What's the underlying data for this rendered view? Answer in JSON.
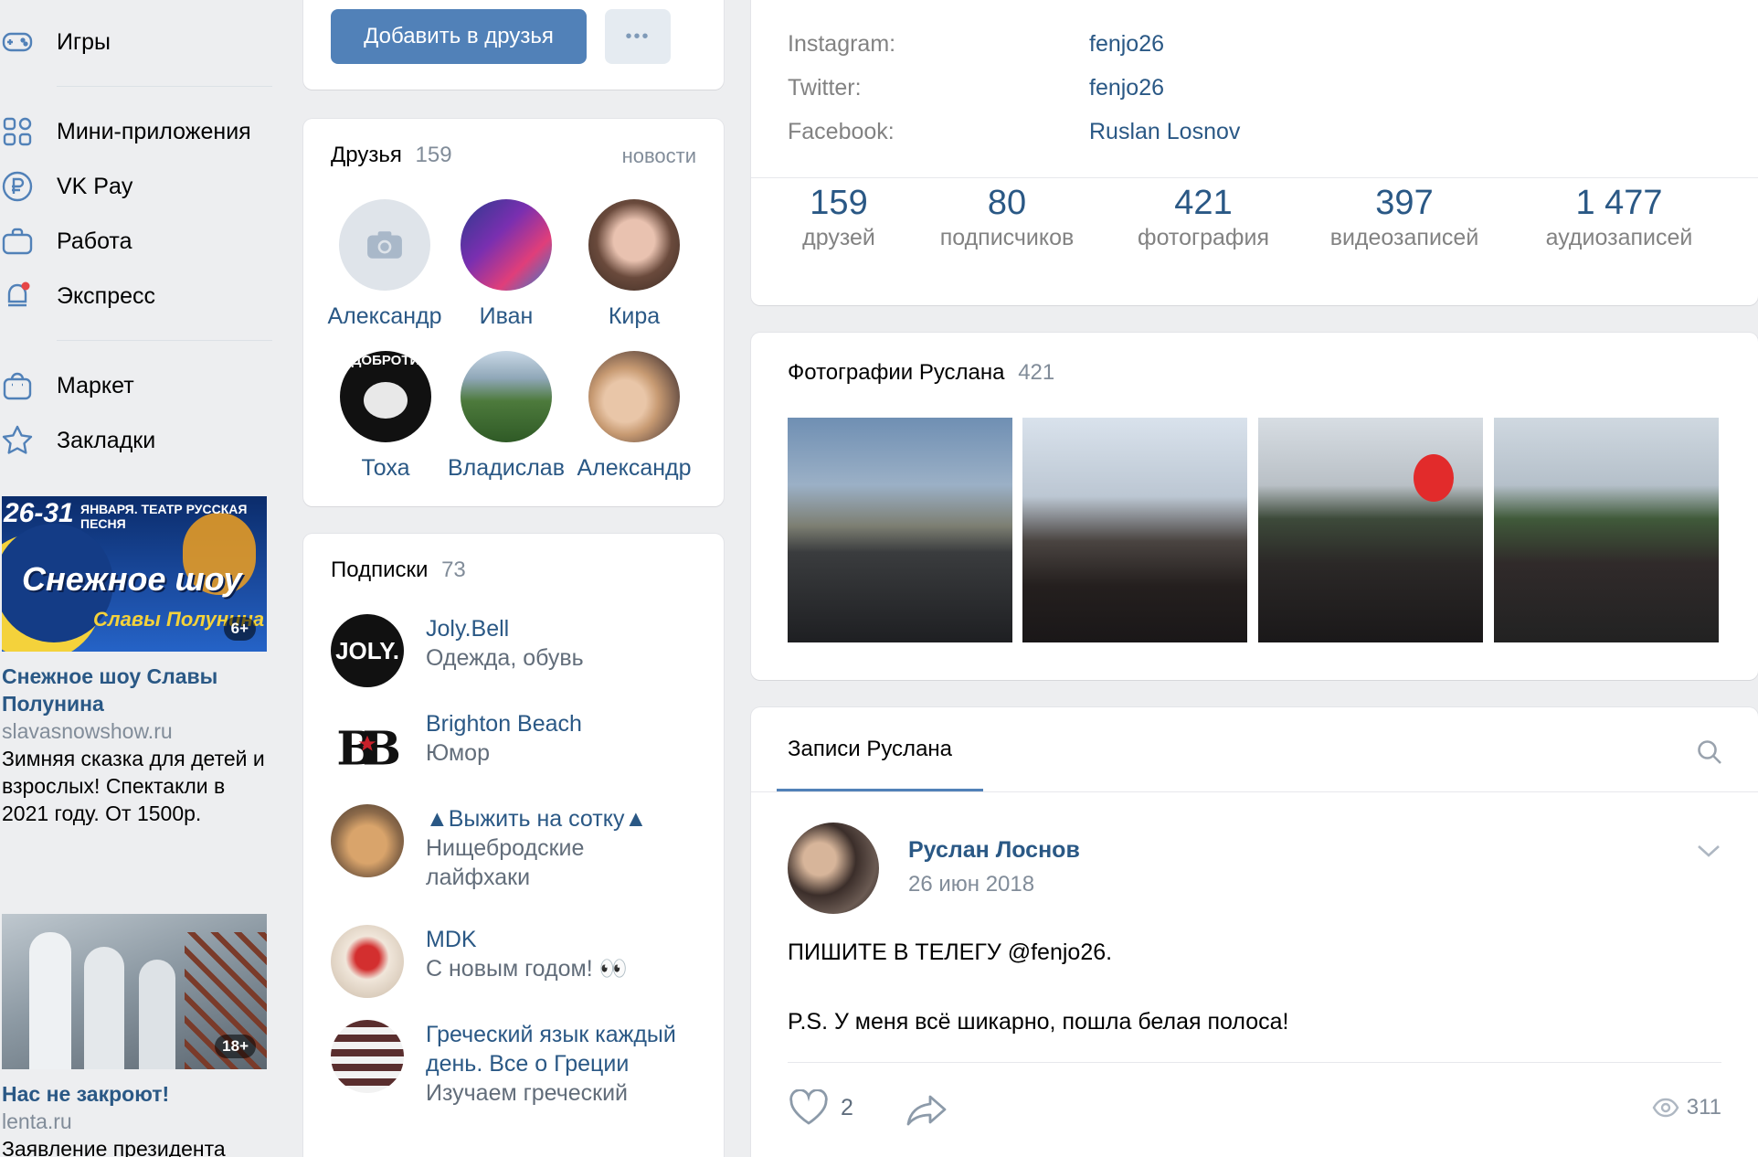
{
  "nav": [
    {
      "label": "Игры",
      "icon": "gamepad-icon"
    },
    {
      "label": "Мини-приложения",
      "icon": "apps-icon"
    },
    {
      "label": "VK Pay",
      "icon": "ruble-icon"
    },
    {
      "label": "Работа",
      "icon": "briefcase-icon"
    },
    {
      "label": "Экспресс",
      "icon": "express-icon"
    },
    {
      "label": "Маркет",
      "icon": "market-bag-icon"
    },
    {
      "label": "Закладки",
      "icon": "star-icon"
    }
  ],
  "ads": [
    {
      "banner_top": "26-31",
      "banner_top2": "ЯНВАРЯ. ТЕАТР РУССКАЯ ПЕСНЯ",
      "banner_main": "Снежное шоу",
      "banner_sub": "Славы Полунина",
      "age": "6+",
      "title": "Снежное шоу Славы Полунина",
      "domain": "slavasnowshow.ru",
      "text": "Зимняя сказка для детей и взрослых! Спектакли в 2021 году. От 1500р."
    },
    {
      "age": "18+",
      "title": "Нас не закроют!",
      "domain": "lenta.ru",
      "text": "Заявление президента"
    }
  ],
  "profile_actions": {
    "add_friend": "Добавить в друзья",
    "more": "•••"
  },
  "friends": {
    "title": "Друзья",
    "count": "159",
    "news_link": "новости",
    "items": [
      {
        "name": "Александр"
      },
      {
        "name": "Иван"
      },
      {
        "name": "Кира"
      },
      {
        "name": "Тоха",
        "badge": "ДОБРОТИ"
      },
      {
        "name": "Владислав"
      },
      {
        "name": "Александр"
      }
    ]
  },
  "subscriptions": {
    "title": "Подписки",
    "count": "73",
    "items": [
      {
        "title": "Joly.Bell",
        "desc": "Одежда, обувь",
        "logo": "JOLY."
      },
      {
        "title": "Brighton Beach",
        "desc": "Юмор"
      },
      {
        "title": "▲Выжить на сотку▲",
        "desc": "Нищебродские лайфхаки"
      },
      {
        "title": "MDK",
        "desc": "С новым годом! 👀"
      },
      {
        "title": "Греческий язык каждый день. Все о Греции",
        "desc": "Изучаем греческий"
      }
    ]
  },
  "info": [
    {
      "key": "Instagram:",
      "value": "fenjo26"
    },
    {
      "key": "Twitter:",
      "value": "fenjo26"
    },
    {
      "key": "Facebook:",
      "value": "Ruslan Losnov"
    }
  ],
  "counters": [
    {
      "num": "159",
      "label": "друзей"
    },
    {
      "num": "80",
      "label": "подписчиков"
    },
    {
      "num": "421",
      "label": "фотография"
    },
    {
      "num": "397",
      "label": "видеозаписей"
    },
    {
      "num": "1 477",
      "label": "аудиозаписей"
    }
  ],
  "photos": {
    "title": "Фотографии Руслана",
    "count": "421"
  },
  "wall": {
    "tab": "Записи Руслана",
    "post": {
      "author": "Руслан Лоснов",
      "date": "26 июн 2018",
      "line1": "ПИШИТЕ В ТЕЛЕГУ @fenjo26.",
      "line2": "P.S. У меня всё шикарно, пошла белая полоса!",
      "likes": "2",
      "views": "311"
    }
  },
  "colors": {
    "link": "#2a5885",
    "button": "#5181b8",
    "bg": "#edeef0",
    "muted": "#818c99"
  }
}
